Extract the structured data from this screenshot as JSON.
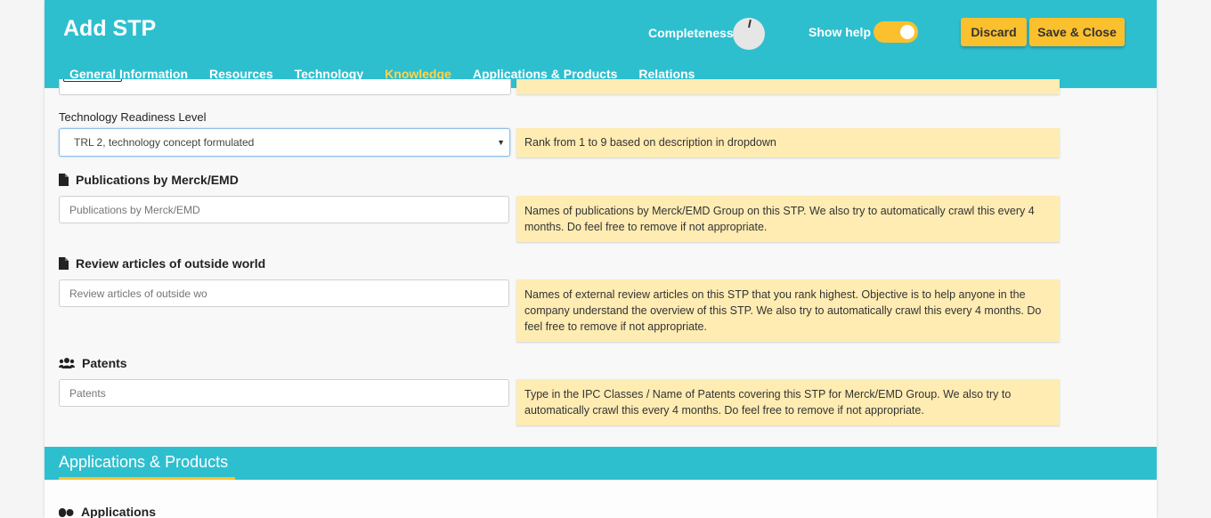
{
  "header": {
    "title": "Add STP",
    "completeness_label": "Completeness",
    "completeness_value": 0.03,
    "show_help_label": "Show help",
    "show_help_on": true,
    "discard_label": "Discard",
    "save_close_label": "Save & Close"
  },
  "tabs": [
    {
      "label": "General Information",
      "active": false
    },
    {
      "label": "Resources",
      "active": false
    },
    {
      "label": "Technology",
      "active": false
    },
    {
      "label": "Knowledge",
      "active": true
    },
    {
      "label": "Applications & Products",
      "active": false
    },
    {
      "label": "Relations",
      "active": false
    }
  ],
  "form": {
    "trl": {
      "label": "Technology Readiness Level",
      "value": "TRL 2, technology concept formulated",
      "help": "Rank from 1 to 9 based on description in dropdown"
    },
    "publications": {
      "label": "Publications by Merck/EMD",
      "icon": "file-icon",
      "placeholder": "Publications by Merck/EMD",
      "help": "Names of publications by Merck/EMD Group on this STP. We also try to automatically crawl this every 4 months. Do feel free to remove if not appropriate."
    },
    "reviews": {
      "label": "Review articles of outside world",
      "icon": "file-icon",
      "placeholder": "Review articles of outside wo",
      "help": "Names of external review articles on this STP that you rank highest. Objective is to help anyone in the company understand the overview of this STP. We also try to automatically crawl this every 4 months. Do feel free to remove if not appropriate."
    },
    "patents": {
      "label": "Patents",
      "icon": "users-icon",
      "placeholder": "Patents",
      "help": "Type in the IPC Classes / Name of Patents covering this STP for Merck/EMD Group. We also try to automatically crawl this every 4 months. Do feel free to remove if not appropriate."
    }
  },
  "section": {
    "title": "Applications & Products",
    "first_field_label": "Applications",
    "first_field_icon": "pills-icon"
  },
  "colors": {
    "header": "#2ebfcf",
    "accent": "#fbc02d",
    "help_bg": "#ffecb3"
  }
}
